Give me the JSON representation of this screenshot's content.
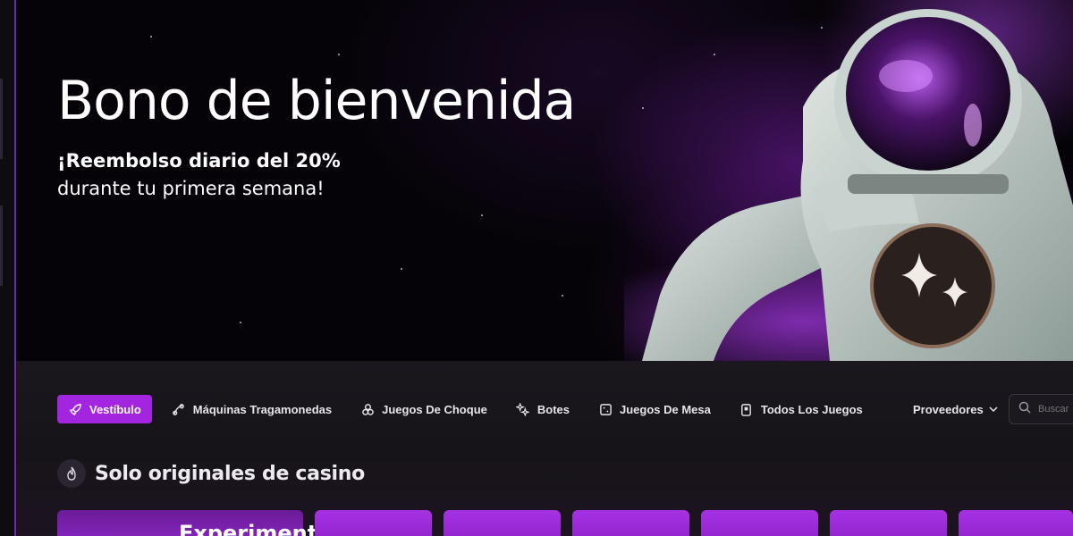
{
  "hero": {
    "title": "Bono de bienvenida",
    "subtitle_bold": "¡Reembolso diario del 20%",
    "subtitle_rest": "durante tu primera semana!"
  },
  "nav": {
    "items": [
      {
        "label": "Vestíbulo",
        "icon": "rocket-icon",
        "active": true
      },
      {
        "label": "Máquinas Tragamonedas",
        "icon": "slot-icon",
        "active": false
      },
      {
        "label": "Juegos De Choque",
        "icon": "crash-icon",
        "active": false
      },
      {
        "label": "Botes",
        "icon": "jackpot-icon",
        "active": false
      },
      {
        "label": "Juegos De Mesa",
        "icon": "table-icon",
        "active": false
      },
      {
        "label": "Todos Los Juegos",
        "icon": "all-games-icon",
        "active": false
      }
    ],
    "providers_label": "Proveedores",
    "search_placeholder": "Buscar"
  },
  "section": {
    "title": "Solo originales de casino",
    "first_card_title": "Experimento"
  },
  "colors": {
    "accent": "#a325e0",
    "background": "#141217"
  }
}
